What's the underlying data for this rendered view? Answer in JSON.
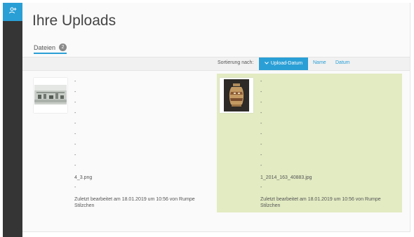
{
  "page": {
    "title": "Ihre Uploads"
  },
  "tabs": [
    {
      "label": "Dateien",
      "count": "2"
    }
  ],
  "sort": {
    "label": "Sortierung nach:",
    "active": "Upload-Datum",
    "options": [
      "Name",
      "Datum"
    ]
  },
  "files": [
    {
      "dash": "-",
      "filename": "4_3.png",
      "edited": "Zuletzt bearbeitet am 18.01.2019 um 10:56 von Rumpe Stilzchen"
    },
    {
      "dash": "-",
      "filename": "1_2014_163_40883.jpg",
      "edited": "Zuletzt bearbeitet am 18.01.2019 um 10:56 von Rumpe Stilzchen"
    }
  ],
  "colors": {
    "accent": "#2a9fd6",
    "sidebar": "#353535",
    "selected_card": "#e2ebc2"
  },
  "icons": {
    "sidebar_active": "user-add-icon",
    "sort_active": "chevron-down-icon"
  }
}
